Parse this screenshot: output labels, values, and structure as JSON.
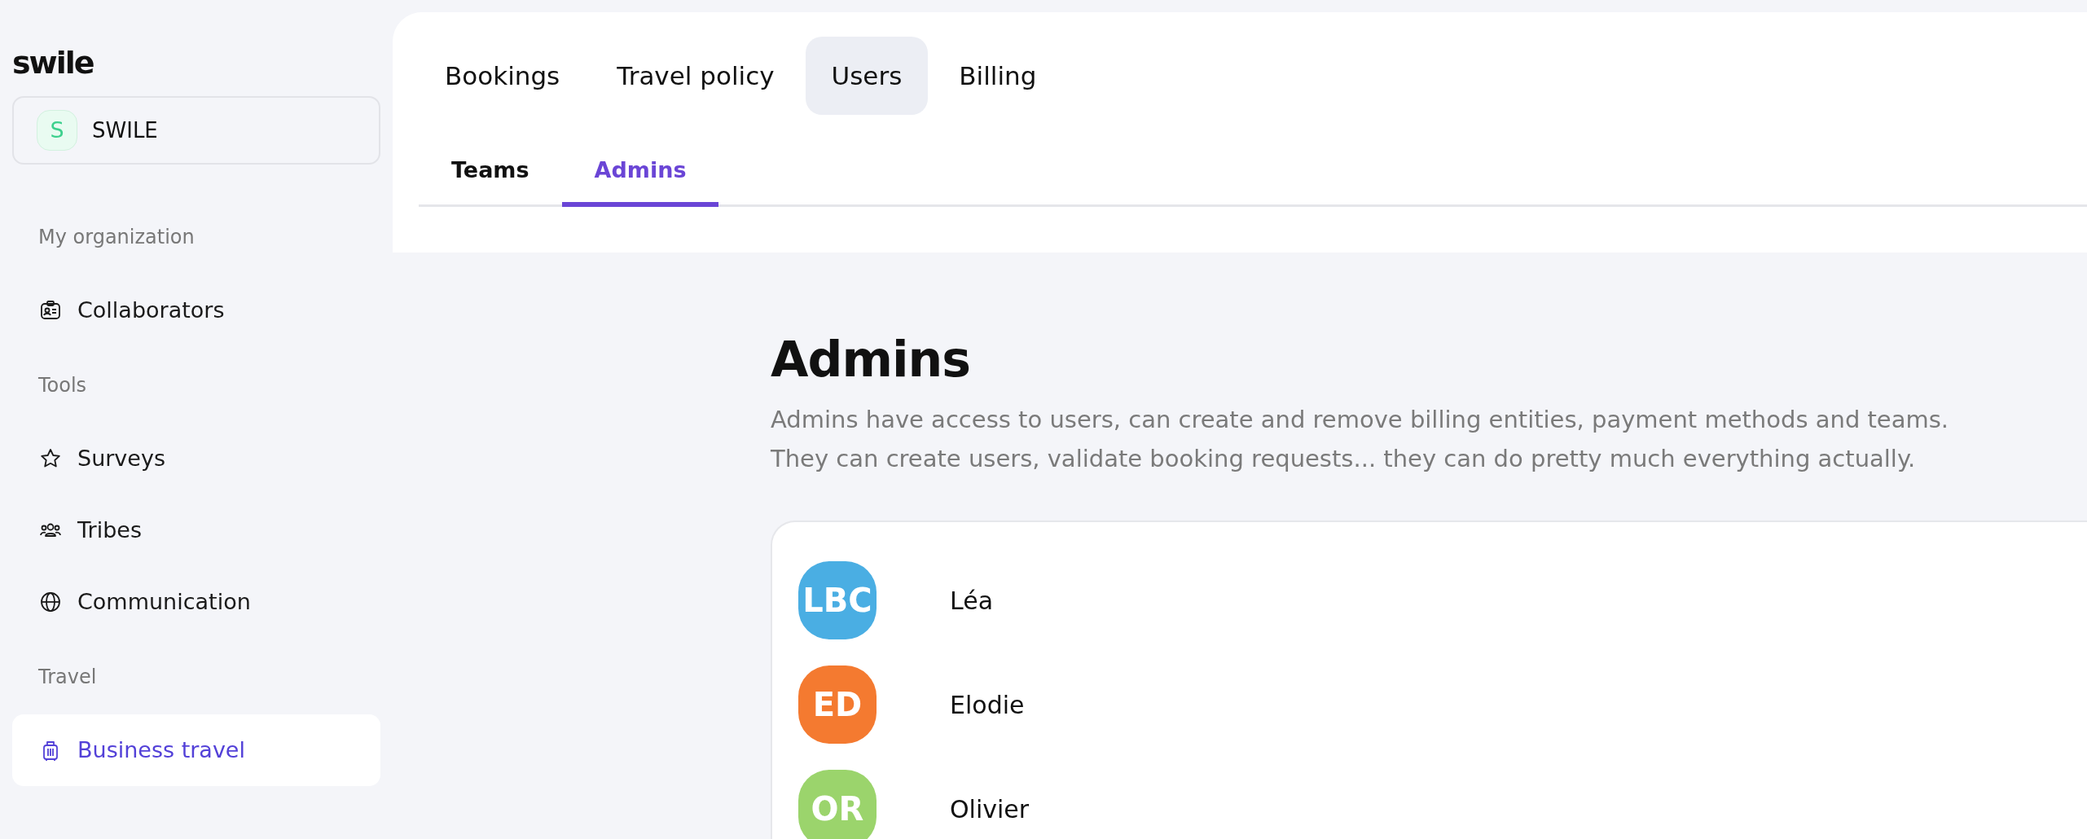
{
  "sidebar": {
    "logo": "swile",
    "organization": {
      "initial": "S",
      "name": "SWILE"
    },
    "sections": [
      {
        "title": "My organization",
        "items": [
          {
            "label": "Collaborators",
            "selected": false
          }
        ]
      },
      {
        "title": "Tools",
        "items": [
          {
            "label": "Surveys",
            "selected": false
          },
          {
            "label": "Tribes",
            "selected": false
          },
          {
            "label": "Communication",
            "selected": false
          }
        ]
      },
      {
        "title": "Travel",
        "items": [
          {
            "label": "Business travel",
            "selected": true
          }
        ]
      }
    ]
  },
  "tabs": [
    {
      "label": "Bookings",
      "selected": false
    },
    {
      "label": "Travel policy",
      "selected": false
    },
    {
      "label": "Users",
      "selected": true
    },
    {
      "label": "Billing",
      "selected": false
    }
  ],
  "subtabs": [
    {
      "label": "Teams",
      "selected": false
    },
    {
      "label": "Admins",
      "selected": true
    }
  ],
  "page": {
    "title": "Admins",
    "description": [
      "Admins have access to users, can create and remove billing entities, payment methods and teams.",
      "They can create users, validate booking requests... they can do pretty much everything actually."
    ]
  },
  "admins": [
    {
      "initials": "LBC",
      "name": "Léa",
      "color": "#4aaee3"
    },
    {
      "initials": "ED",
      "name": "Elodie",
      "color": "#f47a30"
    },
    {
      "initials": "OR",
      "name": "Olivier",
      "color": "#9bd46c"
    }
  ]
}
